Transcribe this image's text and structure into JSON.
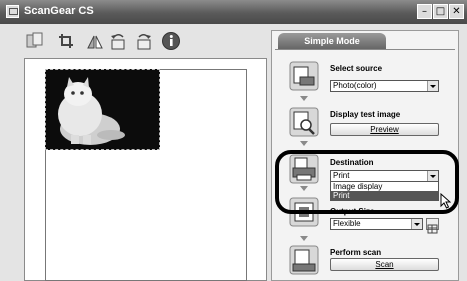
{
  "window": {
    "title": "ScanGear CS"
  },
  "toolbar": {
    "buttons": [
      {
        "icon": "thumbnail-icon"
      },
      {
        "icon": "crop-icon"
      },
      {
        "icon": "mirror-icon"
      },
      {
        "icon": "rotate-left-icon"
      },
      {
        "icon": "rotate-right-icon"
      },
      {
        "icon": "info-icon"
      }
    ]
  },
  "panel": {
    "tab_label": "Simple Mode",
    "steps": {
      "select_source": {
        "label": "Select source",
        "value": "Photo(color)"
      },
      "display_test_image": {
        "label": "Display test image",
        "button": "Preview"
      },
      "destination": {
        "label": "Destination",
        "value": "Print",
        "options": [
          "Image display",
          "Print"
        ],
        "selected": "Print"
      },
      "output_size": {
        "label": "Output Size",
        "value": "Flexible"
      },
      "perform_scan": {
        "label": "Perform scan",
        "button": "Scan"
      }
    }
  },
  "colors": {
    "titlebar": "#5a5a5a",
    "selection": "#555555",
    "ring": "#000000"
  }
}
